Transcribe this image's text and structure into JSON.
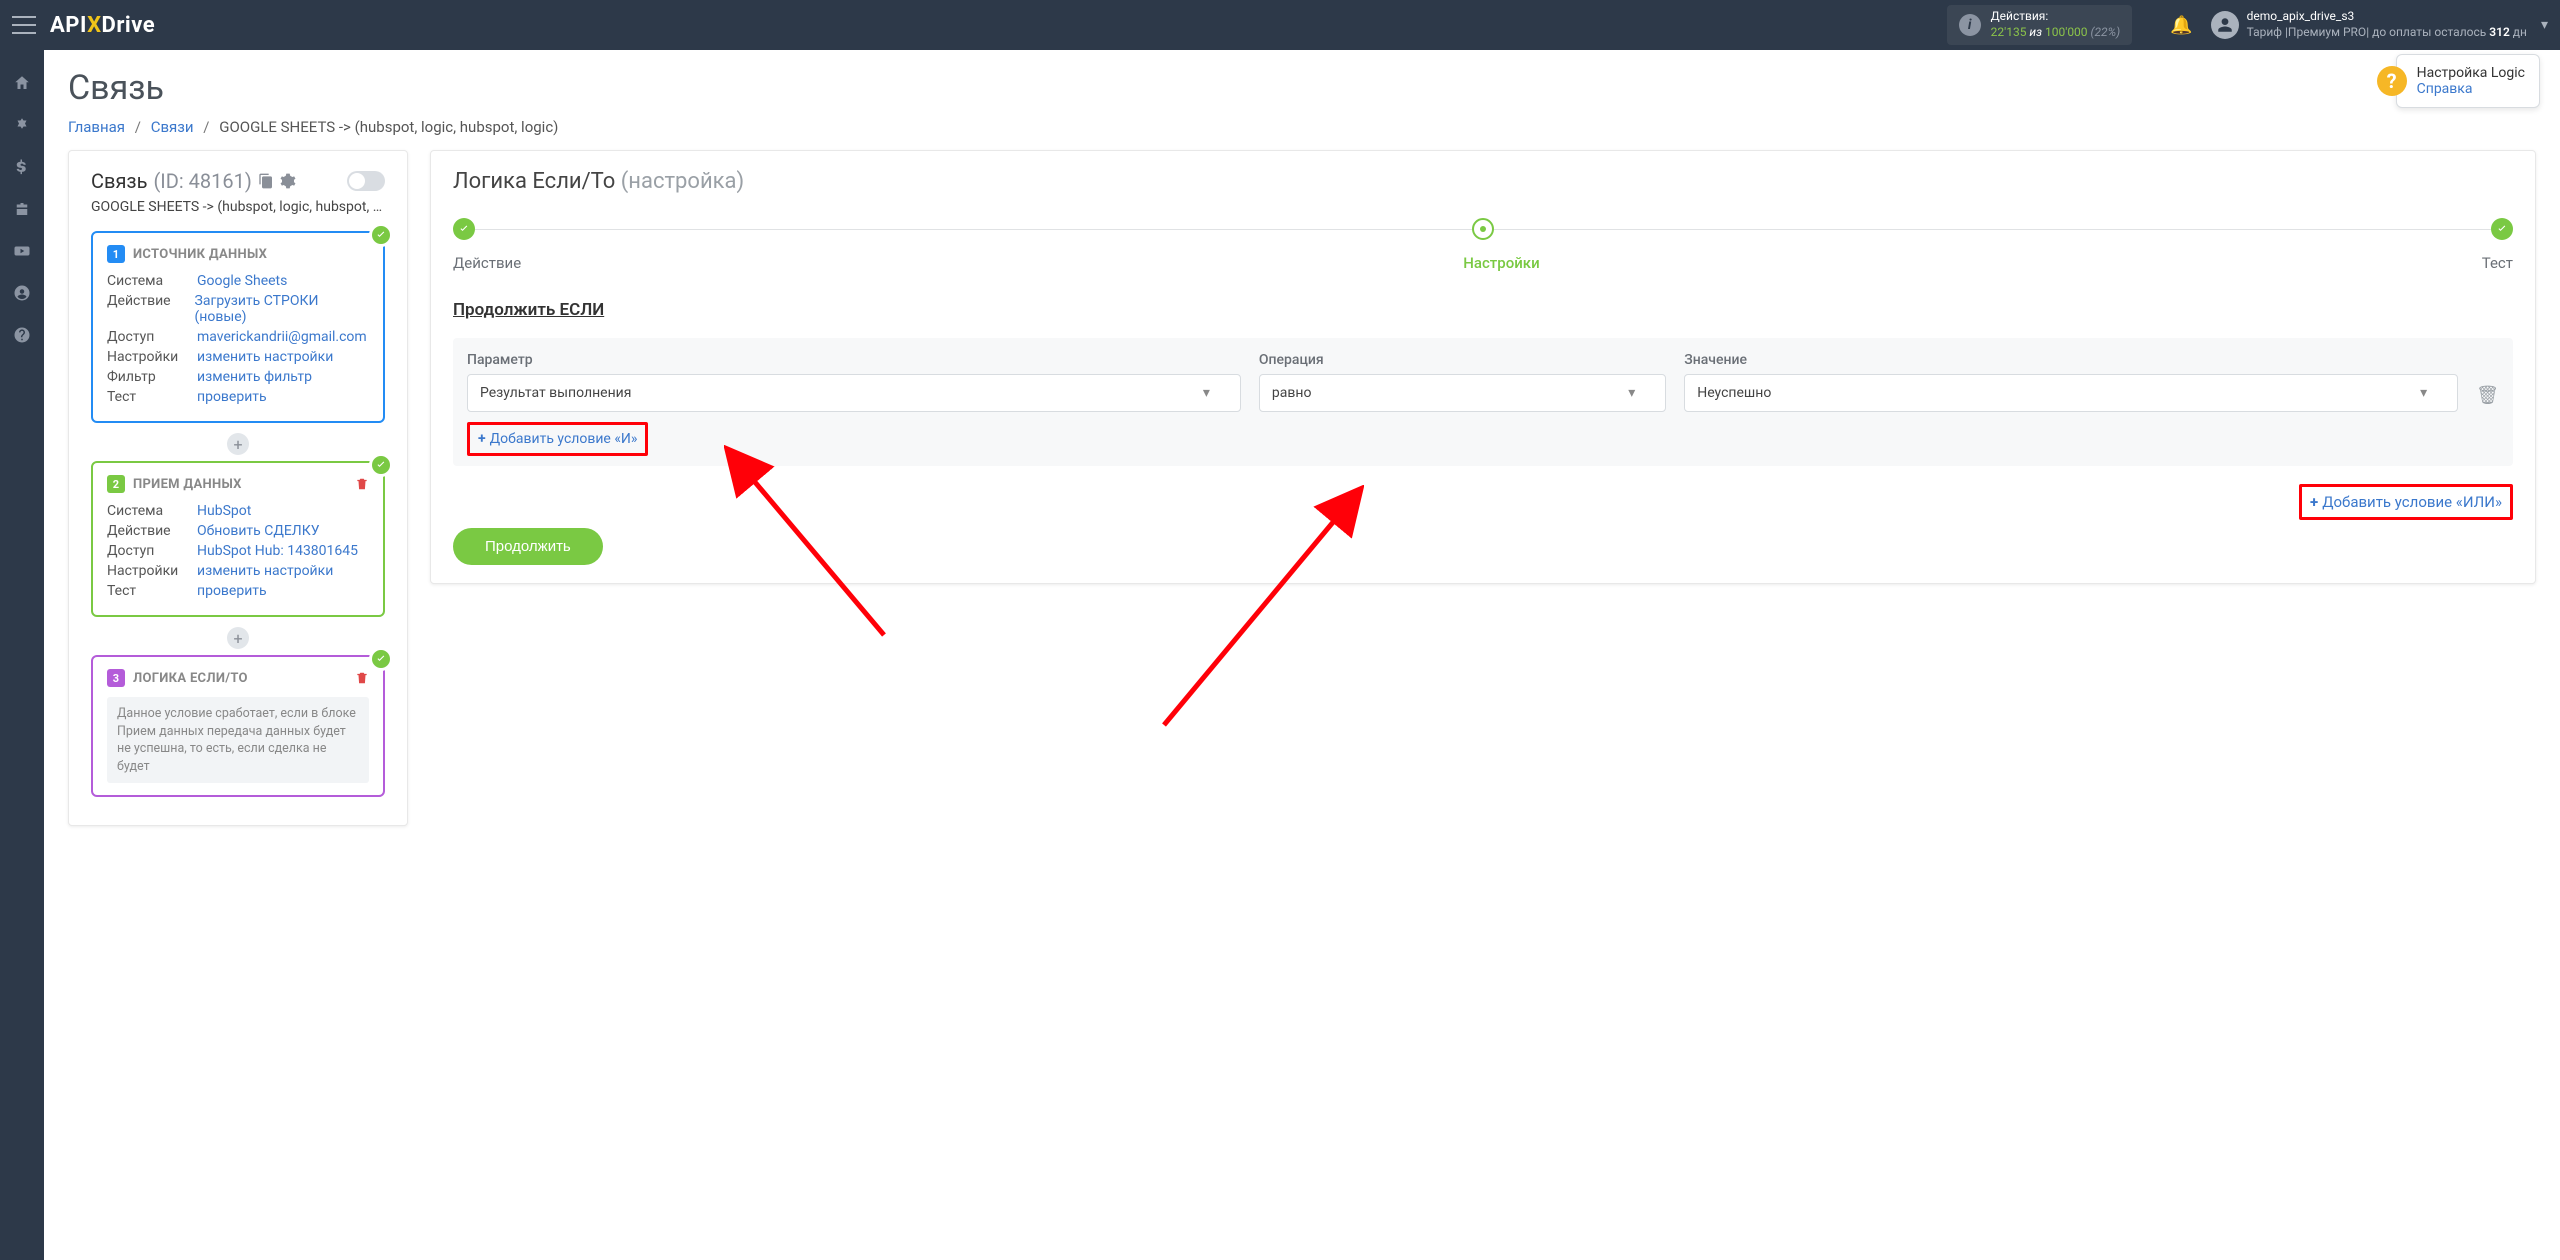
{
  "topbar": {
    "logo_prefix": "API",
    "logo_x": "X",
    "logo_suffix": "Drive",
    "actions_label": "Действия:",
    "actions_current": "22'135",
    "actions_sep": " из ",
    "actions_max": "100'000",
    "actions_pct": "(22%)",
    "user_name": "demo_apix_drive_s3",
    "tariff_prefix": "Тариф |",
    "tariff_name": "Премиум PRO",
    "tariff_suffix": "| до оплаты осталось ",
    "tariff_days": "312",
    "tariff_days_unit": " дн"
  },
  "breadcrumb": {
    "home": "Главная",
    "links": "Связи",
    "current": "GOOGLE SHEETS -> (hubspot, logic, hubspot, logic)"
  },
  "page": {
    "title": "Связь"
  },
  "help": {
    "title": "Настройка Logic",
    "link": "Справка"
  },
  "left": {
    "heading": "Связь",
    "id": "(ID: 48161)",
    "subtitle": "GOOGLE SHEETS -> (hubspot, logic, hubspot, log",
    "card1": {
      "num": "1",
      "title": "ИСТОЧНИК ДАННЫХ",
      "rows": [
        {
          "k": "Система",
          "v": "Google Sheets"
        },
        {
          "k": "Действие",
          "v": "Загрузить СТРОКИ (новые)"
        },
        {
          "k": "Доступ",
          "v": "maverickandrii@gmail.com"
        },
        {
          "k": "Настройки",
          "v": "изменить настройки"
        },
        {
          "k": "Фильтр",
          "v": "изменить фильтр"
        },
        {
          "k": "Тест",
          "v": "проверить"
        }
      ]
    },
    "card2": {
      "num": "2",
      "title": "ПРИЕМ ДАННЫХ",
      "rows": [
        {
          "k": "Система",
          "v": "HubSpot"
        },
        {
          "k": "Действие",
          "v": "Обновить СДЕЛКУ"
        },
        {
          "k": "Доступ",
          "v": "HubSpot Hub: 143801645"
        },
        {
          "k": "Настройки",
          "v": "изменить настройки"
        },
        {
          "k": "Тест",
          "v": "проверить"
        }
      ]
    },
    "card3": {
      "num": "3",
      "title": "ЛОГИКА ЕСЛИ/ТО",
      "desc": "Данное условие сработает, если в блоке Прием данных передача данных будет не успешна, то есть, если сделка не будет"
    }
  },
  "right": {
    "title": "Логика Если/То",
    "title_muted": "(настройка)",
    "steps": [
      "Действие",
      "Настройки",
      "Тест"
    ],
    "section": "Продолжить ЕСЛИ",
    "labels": {
      "param": "Параметр",
      "op": "Операция",
      "val": "Значение"
    },
    "values": {
      "param": "Результат выполнения",
      "op": "равно",
      "val": "Неуспешно"
    },
    "add_and": "Добавить условие «И»",
    "add_or": "Добавить условие «ИЛИ»",
    "continue": "Продолжить"
  }
}
